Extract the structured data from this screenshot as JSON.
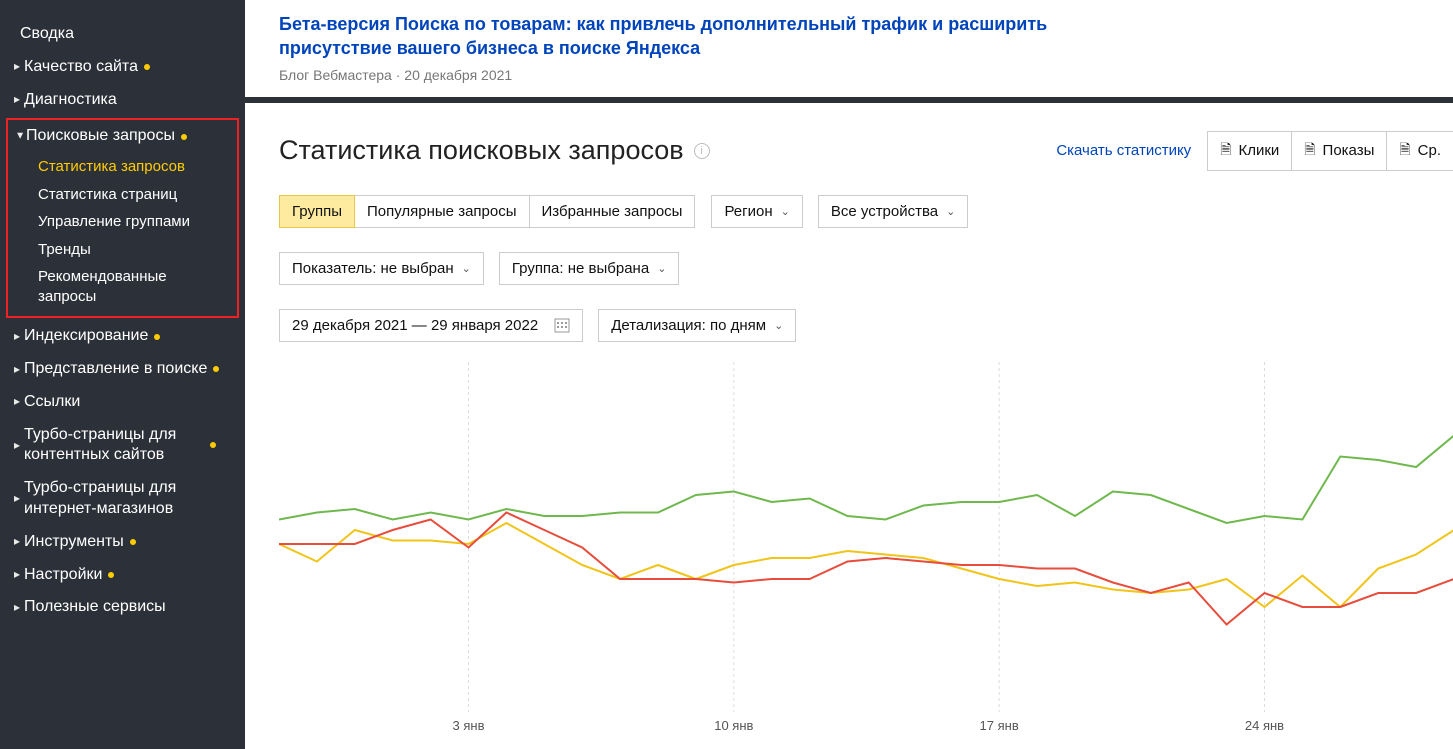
{
  "sidebar": {
    "items": [
      {
        "label": "Сводка",
        "caret": false,
        "dot": false
      },
      {
        "label": "Качество сайта",
        "caret": true,
        "dot": true
      },
      {
        "label": "Диагностика",
        "caret": true,
        "dot": false
      }
    ],
    "search_group": {
      "parent": {
        "label": "Поисковые запросы",
        "dot": true
      },
      "subs": [
        {
          "label": "Статистика запросов",
          "dot": false,
          "active": true
        },
        {
          "label": "Статистика страниц",
          "dot": true,
          "active": false
        },
        {
          "label": "Управление группами",
          "dot": false,
          "active": false
        },
        {
          "label": "Тренды",
          "dot": true,
          "active": false
        },
        {
          "label": "Рекомендованные запросы",
          "dot": false,
          "active": false
        }
      ]
    },
    "items2": [
      {
        "label": "Индексирование",
        "dot": true
      },
      {
        "label": "Представление в поиске",
        "dot": true
      },
      {
        "label": "Ссылки",
        "dot": false
      },
      {
        "label": "Турбо-страницы для контентных сайтов",
        "dot": true
      },
      {
        "label": "Турбо-страницы для интернет-магазинов",
        "dot": false
      },
      {
        "label": "Инструменты",
        "dot": true
      },
      {
        "label": "Настройки",
        "dot": true
      },
      {
        "label": "Полезные сервисы",
        "dot": false
      }
    ]
  },
  "banner": {
    "title": "Бета-версия Поиска по товарам: как привлечь дополнительный трафик и расширить присутствие вашего бизнеса в поиске Яндекса",
    "meta": "Блог Вебмастера · 20 декабря 2021"
  },
  "page": {
    "title": "Статистика поисковых запросов",
    "download": "Скачать статистику",
    "export1": "Клики",
    "export2": "Показы",
    "export3": "Ср."
  },
  "tabs": {
    "groups": "Группы",
    "popular": "Популярные запросы",
    "fav": "Избранные запросы"
  },
  "filters": {
    "region": "Регион",
    "devices": "Все устройства"
  },
  "selects": {
    "indicator": "Показатель: не выбран",
    "group": "Группа: не выбрана"
  },
  "date_range": "29 декабря 2021 — 29 января 2022",
  "detail": "Детализация: по дням",
  "chart_data": {
    "type": "line",
    "title": "",
    "xlabel": "",
    "ylabel": "",
    "ylim": [
      0,
      100
    ],
    "x_ticks": [
      "3 янв",
      "10 янв",
      "17 янв",
      "24 янв"
    ],
    "x_tick_indices": [
      5,
      12,
      19,
      26
    ],
    "x": [
      0,
      1,
      2,
      3,
      4,
      5,
      6,
      7,
      8,
      9,
      10,
      11,
      12,
      13,
      14,
      15,
      16,
      17,
      18,
      19,
      20,
      21,
      22,
      23,
      24,
      25,
      26,
      27,
      28,
      29,
      30,
      31
    ],
    "series": [
      {
        "name": "green",
        "color": "#6fb84d",
        "values": [
          55,
          57,
          58,
          55,
          57,
          55,
          58,
          56,
          56,
          57,
          57,
          62,
          63,
          60,
          61,
          56,
          55,
          59,
          60,
          60,
          62,
          56,
          63,
          62,
          58,
          54,
          56,
          55,
          73,
          72,
          70,
          79
        ]
      },
      {
        "name": "yellow",
        "color": "#f0c419",
        "values": [
          48,
          43,
          52,
          49,
          49,
          48,
          54,
          48,
          42,
          38,
          42,
          38,
          42,
          44,
          44,
          46,
          45,
          44,
          41,
          38,
          36,
          37,
          35,
          34,
          35,
          38,
          30,
          39,
          30,
          41,
          45,
          52
        ]
      },
      {
        "name": "red",
        "color": "#e74c3c",
        "values": [
          48,
          48,
          48,
          52,
          55,
          47,
          57,
          52,
          47,
          38,
          38,
          38,
          37,
          38,
          38,
          43,
          44,
          43,
          42,
          42,
          41,
          41,
          37,
          34,
          37,
          25,
          34,
          30,
          30,
          34,
          34,
          38
        ]
      }
    ]
  }
}
